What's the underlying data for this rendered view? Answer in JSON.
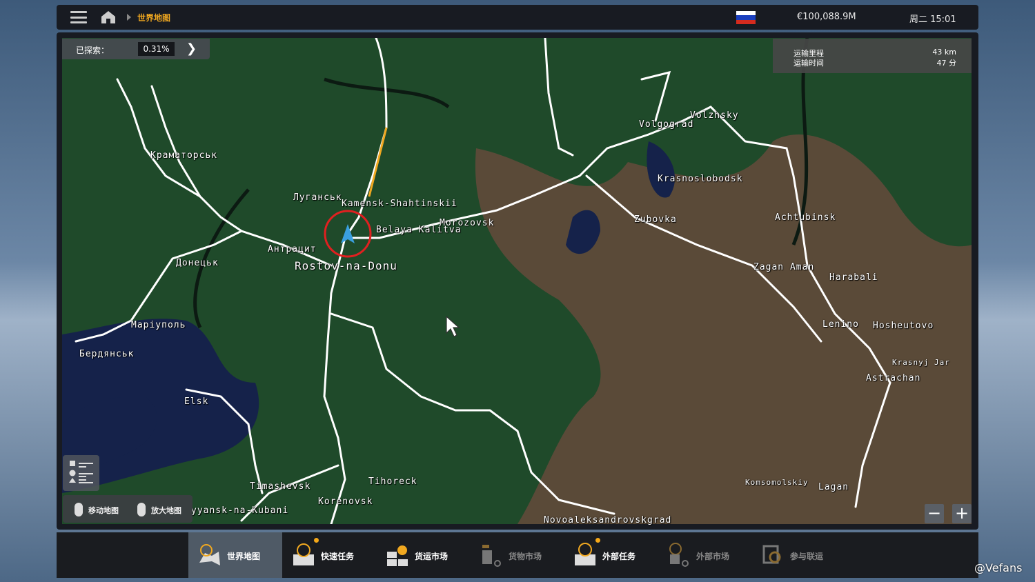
{
  "topbar": {
    "breadcrumb": "世界地图",
    "money": "€100,088.9M",
    "clock": "周二 15:01",
    "flag_colors": [
      "#ffffff",
      "#1a3fbf",
      "#d52b1e"
    ]
  },
  "explored": {
    "label": "已探索：",
    "value": "0.31%"
  },
  "route": {
    "distance_label": "运输里程",
    "distance": "43 km",
    "time_label": "运输时间",
    "time": "47 分"
  },
  "cities": [
    {
      "name": "Краматорськ"
    },
    {
      "name": "Луганськ"
    },
    {
      "name": "Kamensk-Shahtinskii"
    },
    {
      "name": "Morozovsk"
    },
    {
      "name": "Belaya Kalitva"
    },
    {
      "name": "Антрацит"
    },
    {
      "name": "Донецьк"
    },
    {
      "name": "Rostov-na-Donu"
    },
    {
      "name": "Маріуполь"
    },
    {
      "name": "Бердянськ"
    },
    {
      "name": "Elsk"
    },
    {
      "name": "Timashevsk"
    },
    {
      "name": "Korenovsk"
    },
    {
      "name": "Tihoreck"
    },
    {
      "name": "yyansk-na-Kubani"
    },
    {
      "name": "Novoaleksandrovskgrad"
    },
    {
      "name": "Volgograd"
    },
    {
      "name": "Volzhsky"
    },
    {
      "name": "Krasnoslobodsk"
    },
    {
      "name": "Zubovka"
    },
    {
      "name": "Achtubinsk"
    },
    {
      "name": "Zagan Aman"
    },
    {
      "name": "Harabali"
    },
    {
      "name": "Lenino"
    },
    {
      "name": "Hosheutovo"
    },
    {
      "name": "Krasnyj Jar"
    },
    {
      "name": "Astrachan"
    },
    {
      "name": "Komsomolskiy"
    },
    {
      "name": "Lagan"
    }
  ],
  "hints": {
    "move": "移动地图",
    "zoom": "放大地图"
  },
  "zoom_controls": {
    "out": "−",
    "in": "+"
  },
  "tabs": [
    {
      "label": "世界地图",
      "icon": "world-map-icon",
      "active": true
    },
    {
      "label": "快速任务",
      "icon": "quick-job-icon",
      "badge": true
    },
    {
      "label": "货运市场",
      "icon": "freight-market-icon"
    },
    {
      "label": "货物市场",
      "icon": "cargo-market-icon",
      "disabled": true
    },
    {
      "label": "外部任务",
      "icon": "external-jobs-icon",
      "badge": true
    },
    {
      "label": "外部市场",
      "icon": "external-market-icon",
      "disabled": true
    },
    {
      "label": "参与联运",
      "icon": "convoy-icon",
      "disabled": true
    }
  ],
  "colors": {
    "accent": "#f0a820",
    "land": "#1f4a2a",
    "steppe": "#5a4a38",
    "sea": "#15224a"
  },
  "watermark": "@Vefans"
}
